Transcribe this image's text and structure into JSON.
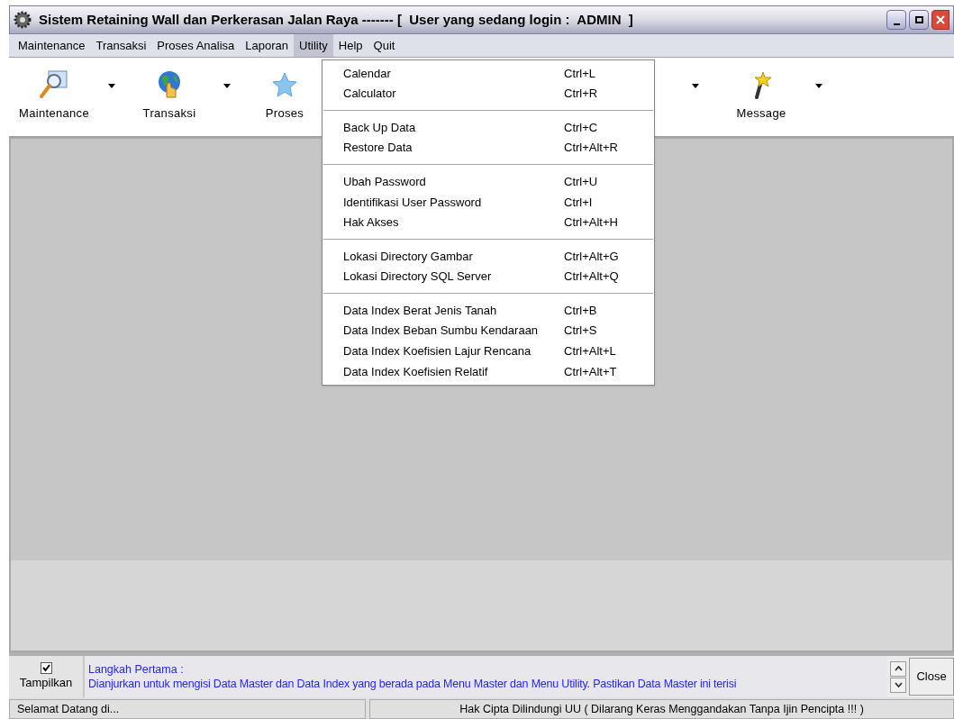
{
  "window": {
    "title": "Sistem Retaining Wall dan Perkerasan Jalan Raya ------- [  User yang sedang login :  ADMIN  ]"
  },
  "menu_bar": [
    {
      "label": "Maintenance",
      "selected": false
    },
    {
      "label": "Transaksi",
      "selected": false
    },
    {
      "label": "Proses Analisa",
      "selected": false
    },
    {
      "label": "Laporan",
      "selected": false
    },
    {
      "label": "Utility",
      "selected": true
    },
    {
      "label": "Help",
      "selected": false
    },
    {
      "label": "Quit",
      "selected": false
    }
  ],
  "toolbar": [
    {
      "label": "Maintenance",
      "kind": "search",
      "dropdown": true
    },
    {
      "label": "Transaksi",
      "kind": "globe",
      "dropdown": true
    },
    {
      "label": "Proses",
      "kind": "star"
    },
    {
      "label": "Message",
      "kind": "wand",
      "dropdown": true
    }
  ],
  "utility_menu": {
    "groups": [
      [
        {
          "label": "Calendar",
          "shortcut": "Ctrl+L"
        },
        {
          "label": "Calculator",
          "shortcut": "Ctrl+R"
        }
      ],
      [
        {
          "label": "Back Up Data",
          "shortcut": "Ctrl+C"
        },
        {
          "label": "Restore Data",
          "shortcut": "Ctrl+Alt+R"
        }
      ],
      [
        {
          "label": "Ubah Password",
          "shortcut": "Ctrl+U"
        },
        {
          "label": "Identifikasi User Password",
          "shortcut": "Ctrl+I"
        },
        {
          "label": "Hak Akses",
          "shortcut": "Ctrl+Alt+H"
        }
      ],
      [
        {
          "label": "Lokasi Directory Gambar",
          "shortcut": "Ctrl+Alt+G"
        },
        {
          "label": "Lokasi Directory SQL Server",
          "shortcut": "Ctrl+Alt+Q"
        }
      ],
      [
        {
          "label": "Data Index Berat Jenis Tanah",
          "shortcut": "Ctrl+B"
        },
        {
          "label": "Data Index Beban Sumbu Kendaraan",
          "shortcut": "Ctrl+S"
        },
        {
          "label": "Data Index Koefisien Lajur Rencana",
          "shortcut": "Ctrl+Alt+L"
        },
        {
          "label": "Data Index Koefisien Relatif",
          "shortcut": "Ctrl+Alt+T"
        }
      ]
    ]
  },
  "info_panel": {
    "show_checkbox": {
      "label": "Tampilkan",
      "checked": true
    },
    "heading": "Langkah Pertama :",
    "message": "Dianjurkan untuk mengisi Data Master dan Data Index yang berada pada Menu Master dan Menu Utility. Pastikan Data Master ini terisi",
    "close_button": "Close"
  },
  "status_bar": [
    "Selamat Datang di...",
    "Hak Cipta Dilindungi UU ( Dilarang Keras Menggandakan Tanpa Ijin Pencipta !!! )"
  ]
}
